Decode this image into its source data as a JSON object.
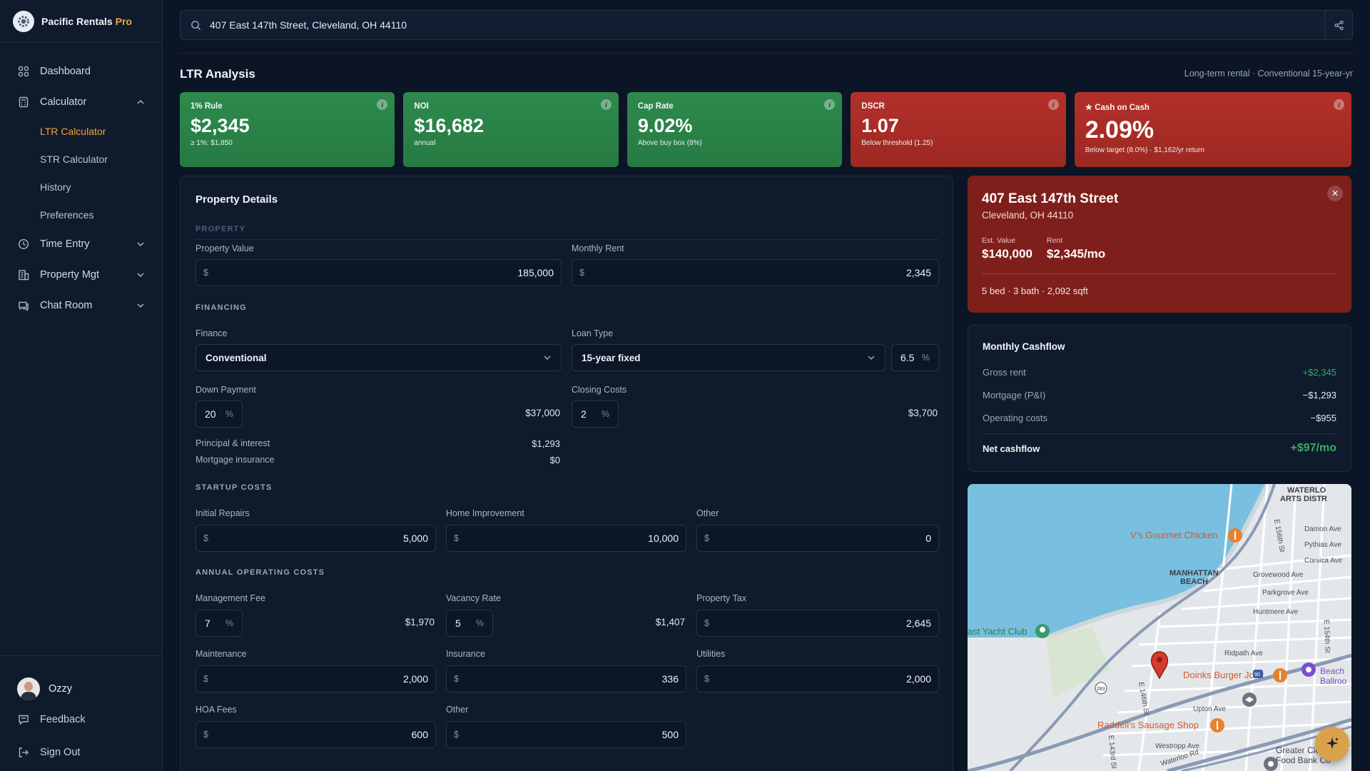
{
  "brand": {
    "name": "Pacific Rentals",
    "tier": "Pro"
  },
  "nav": {
    "dashboard": "Dashboard",
    "calculator": "Calculator",
    "calculator_sub": [
      "LTR Calculator",
      "STR Calculator",
      "History",
      "Preferences"
    ],
    "time_entry": "Time Entry",
    "property_mgt": "Property Mgt",
    "chat_room": "Chat Room"
  },
  "user": {
    "name": "Ozzy"
  },
  "bottom": {
    "feedback": "Feedback",
    "sign_out": "Sign Out"
  },
  "search": {
    "value": "407 East 147th Street, Cleveland, OH 44110"
  },
  "page": {
    "title": "LTR Analysis",
    "subtitle": "Long-term rental · Conventional 15-year-yr"
  },
  "metrics": [
    {
      "label": "1% Rule",
      "value": "$2,345",
      "note": "≥ 1%: $1,850",
      "status": "pass"
    },
    {
      "label": "NOI",
      "value": "$16,682",
      "note": "annual",
      "status": "pass"
    },
    {
      "label": "Cap Rate",
      "value": "9.02%",
      "note": "Above buy box (8%)",
      "status": "pass"
    },
    {
      "label": "DSCR",
      "value": "1.07",
      "note": "Below threshold (1.25)",
      "status": "fail"
    },
    {
      "label": "★ Cash on Cash",
      "value": "2.09%",
      "note": "Below target (8.0%) · $1,162/yr return",
      "status": "fail"
    }
  ],
  "details": {
    "title": "Property Details",
    "sections": {
      "property": "PROPERTY",
      "financing": "FINANCING",
      "startup": "STARTUP COSTS",
      "operating": "ANNUAL OPERATING COSTS"
    },
    "currency": "$",
    "pct": "%",
    "property_value": {
      "label": "Property Value",
      "value": "185,000"
    },
    "monthly_rent": {
      "label": "Monthly Rent",
      "value": "2,345"
    },
    "finance": {
      "label": "Finance",
      "value": "Conventional"
    },
    "loan_type": {
      "label": "Loan Type",
      "value": "15-year fixed",
      "rate": "6.5"
    },
    "down_payment": {
      "label": "Down Payment",
      "pct": "20",
      "amount": "$37,000"
    },
    "closing_costs": {
      "label": "Closing Costs",
      "pct": "2",
      "amount": "$3,700"
    },
    "pi": {
      "label": "Principal & interest",
      "value": "$1,293"
    },
    "mi": {
      "label": "Mortgage insurance",
      "value": "$0"
    },
    "initial_repairs": {
      "label": "Initial Repairs",
      "value": "5,000"
    },
    "home_improvement": {
      "label": "Home Improvement",
      "value": "10,000"
    },
    "startup_other": {
      "label": "Other",
      "value": "0"
    },
    "management_fee": {
      "label": "Management Fee",
      "pct": "7",
      "amount": "$1,970"
    },
    "vacancy_rate": {
      "label": "Vacancy Rate",
      "pct": "5",
      "amount": "$1,407"
    },
    "property_tax": {
      "label": "Property Tax",
      "value": "2,645"
    },
    "maintenance": {
      "label": "Maintenance",
      "value": "2,000"
    },
    "insurance": {
      "label": "Insurance",
      "value": "336"
    },
    "utilities": {
      "label": "Utilities",
      "value": "2,000"
    },
    "hoa": {
      "label": "HOA Fees",
      "value": "600"
    },
    "op_other": {
      "label": "Other",
      "value": "500"
    }
  },
  "property_card": {
    "address": "407 East 147th Street",
    "city": "Cleveland, OH 44110",
    "est_value_label": "Est. Value",
    "est_value": "$140,000",
    "rent_label": "Rent",
    "rent": "$2,345/mo",
    "specs": "5 bed · 3 bath · 2,092 sqft"
  },
  "cashflow": {
    "title": "Monthly Cashflow",
    "rows": [
      {
        "label": "Gross rent",
        "value": "+$2,345"
      },
      {
        "label": "Mortgage (P&I)",
        "value": "−$1,293"
      },
      {
        "label": "Operating costs",
        "value": "−$955"
      }
    ],
    "net_label": "Net cashflow",
    "net_value": "+$97/mo"
  },
  "map": {
    "labels": {
      "district": "WATERLO",
      "district2": "ARTS DISTR",
      "gourmet": "V's Gourmet Chicken",
      "manhattan": "MANHATTAN",
      "beach": "BEACH",
      "yacht": "ast Yacht Club",
      "doinks": "Doinks Burger Joint",
      "raddell": "Raddell's Sausage Shop",
      "damon": "Damon Ave",
      "pythias": "Pythias Ave",
      "corsica": "Corsica Ave",
      "grovewood": "Grovewood Ave",
      "parkgrove": "Parkgrove Ave",
      "huntmere": "Huntmere Ave",
      "ridpath": "Ridpath Ave",
      "upton": "Upton Ave",
      "westropp": "Westropp Ave",
      "waterloo": "Waterloo Rd",
      "e156": "E 156th St",
      "e154": "E 154th St",
      "e146": "E 146th St",
      "e143": "E 143rd St",
      "beach_ballroom": "Beach",
      "ballroom": "Ballroo",
      "greater": "Greater Clevel",
      "food_bank": "Food Bank Co",
      "r283": "283",
      "r90": "90"
    }
  },
  "colors": {
    "accent": "#f2a33a",
    "pass": "#2e8a4c",
    "fail": "#b4302a",
    "bg": "#0b1525"
  }
}
